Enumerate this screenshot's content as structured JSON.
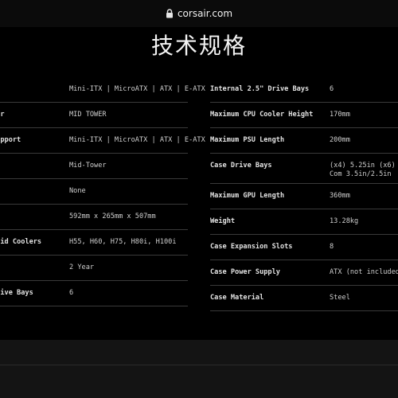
{
  "browser": {
    "url": "corsair.com"
  },
  "page": {
    "title": "技术规格"
  },
  "specs_left": [
    {
      "key": "d",
      "value": "Mini-ITX | MicroATX | ATX | E-ATX"
    },
    {
      "key": "tor",
      "value": "MID TOWER"
    },
    {
      "key": "Support",
      "value": "Mini-ITX | MicroATX | ATX | E-ATX"
    },
    {
      "key": "",
      "value": "Mid-Tower"
    },
    {
      "key": "",
      "value": "None"
    },
    {
      "key": "ns",
      "value": "592mm x 265mm x 507mm"
    },
    {
      "key": "quid Coolers",
      "value": "H55, H60, H75, H80i, H100i"
    },
    {
      "key": "",
      "value": "2 Year"
    },
    {
      "key": "Drive Bays",
      "value": "6"
    }
  ],
  "specs_right": [
    {
      "key": "Internal 2.5\" Drive Bays",
      "value": "6"
    },
    {
      "key": "Maximum CPU Cooler Height",
      "value": "170mm"
    },
    {
      "key": "Maximum PSU Length",
      "value": "200mm"
    },
    {
      "key": "Case Drive Bays",
      "value": "(x4) 5.25in (x6) Com 3.5in/2.5in"
    },
    {
      "key": "Maximum GPU Length",
      "value": "360mm"
    },
    {
      "key": "Weight",
      "value": "13.28kg"
    },
    {
      "key": "Case Expansion Slots",
      "value": "8"
    },
    {
      "key": "Case Power Supply",
      "value": "ATX (not included)"
    },
    {
      "key": "Case Material",
      "value": "Steel"
    }
  ]
}
